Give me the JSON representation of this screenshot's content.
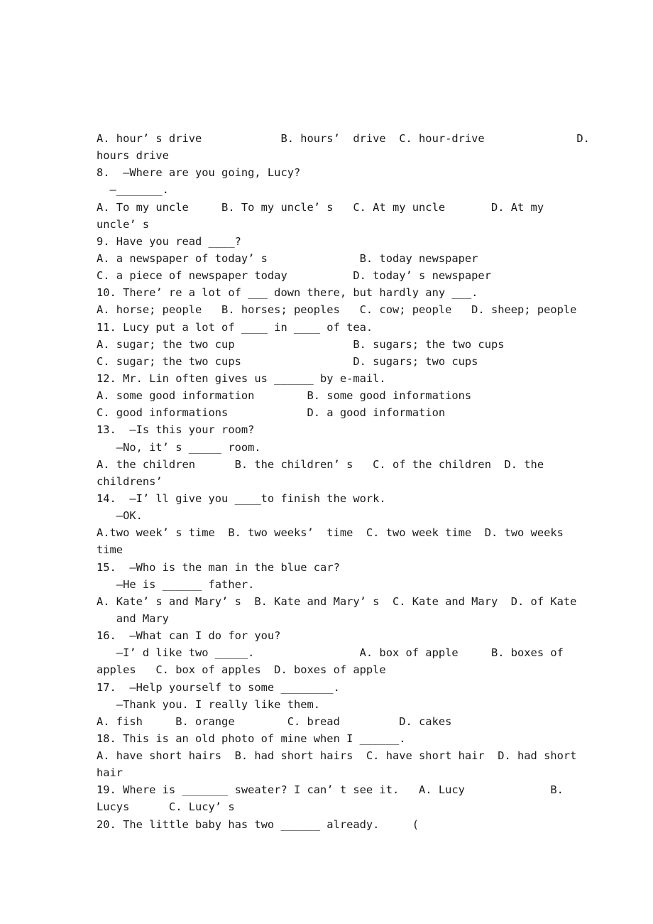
{
  "document": {
    "type": "english-grammar-worksheet",
    "page_background": "#ffffff",
    "text_color": "#1a1a1a",
    "lines": [
      "A. hour’ s drive            B. hours’  drive  C. hour-drive              D.",
      "hours drive",
      "8.  –Where are you going, Lucy?",
      "  –_______.",
      "A. To my uncle     B. To my uncle’ s   C. At my uncle       D. At my",
      "uncle’ s",
      "9. Have you read ____?",
      "A. a newspaper of today’ s              B. today newspaper",
      "C. a piece of newspaper today          D. today’ s newspaper",
      "10. There’ re a lot of ___ down there, but hardly any ___.",
      "A. horse; people   B. horses; peoples   C. cow; people   D. sheep; people",
      "11. Lucy put a lot of ____ in ____ of tea.",
      "A. sugar; the two cup                  B. sugars; the two cups",
      "C. sugar; the two cups                 D. sugars; two cups",
      "12. Mr. Lin often gives us ______ by e-mail.",
      "A. some good information        B. some good informations",
      "C. good informations            D. a good information",
      "13.  –Is this your room?",
      "   –No, it’ s _____ room.",
      "A. the children      B. the children’ s   C. of the children  D. the",
      "childrens’",
      "14.  –I’ ll give you ____to finish the work.",
      "   –OK.",
      "A.two week’ s time  B. two weeks’  time  C. two week time  D. two weeks",
      "time",
      "15.  –Who is the man in the blue car?",
      "   –He is ______ father.",
      "A. Kate’ s and Mary’ s  B. Kate and Mary’ s  C. Kate and Mary  D. of Kate",
      "   and Mary",
      "16.  –What can I do for you?",
      "   –I’ d like two _____.                A. box of apple     B. boxes of",
      "apples   C. box of apples  D. boxes of apple",
      "17.  –Help yourself to some ________.",
      "   –Thank you. I really like them.",
      "A. fish     B. orange        C. bread         D. cakes",
      "18. This is an old photo of mine when I ______.",
      "A. have short hairs  B. had short hairs  C. have short hair  D. had short",
      "hair",
      "19. Where is _______ sweater? I can’ t see it.   A. Lucy             B.",
      "Lucys      C. Lucy’ s",
      "20. The little baby has two ______ already.     ("
    ],
    "indents": [
      0,
      0,
      0,
      0,
      0,
      0,
      0,
      0,
      0,
      0,
      0,
      0,
      0,
      0,
      0,
      0,
      0,
      0,
      0,
      0,
      0,
      0,
      0,
      0,
      0,
      0,
      0,
      0,
      0,
      0,
      0,
      0,
      0,
      0,
      0,
      0,
      0,
      0,
      0,
      0,
      0
    ]
  }
}
